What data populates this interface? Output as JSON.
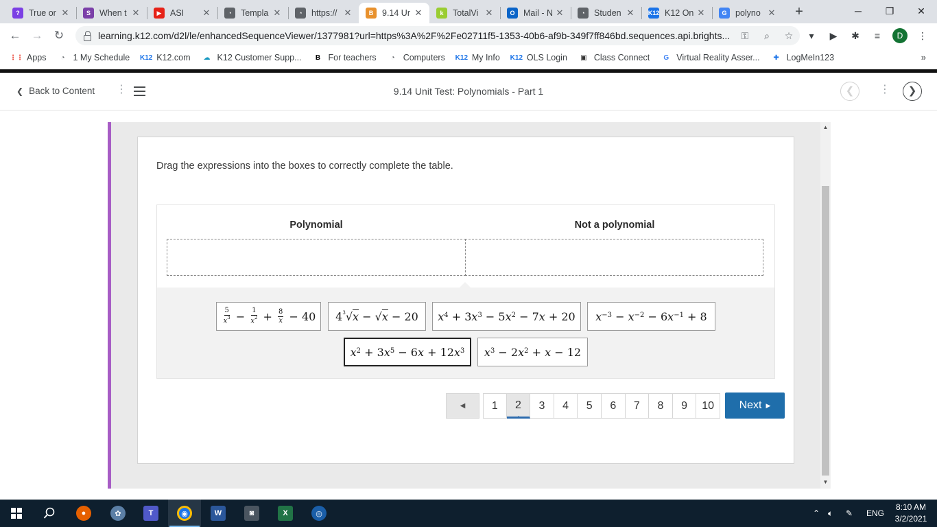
{
  "browser": {
    "tabs": [
      {
        "title": "True or",
        "fav": "?",
        "color": "#7b3fe4"
      },
      {
        "title": "When t",
        "fav": "S",
        "color": "#7b3fa8"
      },
      {
        "title": "ASI",
        "fav": "▶",
        "color": "#e62117"
      },
      {
        "title": "Templa",
        "fav": "◔",
        "color": "#5f6368"
      },
      {
        "title": "https://",
        "fav": "◔",
        "color": "#5f6368"
      },
      {
        "title": "9.14 Ur",
        "fav": "B",
        "color": "#e8912d"
      },
      {
        "title": "TotalVi",
        "fav": "k",
        "color": "#9acd32"
      },
      {
        "title": "Mail - N",
        "fav": "O",
        "color": "#0a64c8"
      },
      {
        "title": "Studen",
        "fav": "◔",
        "color": "#5f6368"
      },
      {
        "title": "K12 On",
        "fav": "K12",
        "color": "#1a73e8"
      },
      {
        "title": "polyno",
        "fav": "G",
        "color": "#4285f4"
      }
    ],
    "url": "learning.k12.com/d2l/le/enhancedSequenceViewer/1377981?url=https%3A%2F%2Fe02711f5-1353-40b6-af9b-349f7ff846bd.sequences.api.brights...",
    "avatar_letter": "D",
    "bookmarks": [
      {
        "label": "Apps",
        "icon": "apps-grid-icon"
      },
      {
        "label": "1 My Schedule",
        "icon": "globe-icon"
      },
      {
        "label": "K12.com",
        "icon": "k12-icon"
      },
      {
        "label": "K12 Customer Supp...",
        "icon": "cloud-icon"
      },
      {
        "label": "For teachers",
        "icon": "brainly-icon"
      },
      {
        "label": "Computers",
        "icon": "globe-icon"
      },
      {
        "label": "My Info",
        "icon": "k12-icon"
      },
      {
        "label": "OLS Login",
        "icon": "k12-icon"
      },
      {
        "label": "Class Connect",
        "icon": "video-icon"
      },
      {
        "label": "Virtual Reality Asser...",
        "icon": "google-icon"
      },
      {
        "label": "LogMeIn123",
        "icon": "logmein-icon"
      }
    ],
    "more_bookmarks": "»"
  },
  "nav": {
    "back_label": "Back to Content",
    "page_title": "9.14 Unit Test: Polynomials - Part 1"
  },
  "question": {
    "instructions": "Drag the expressions into the boxes to correctly complete the table.",
    "columns": [
      "Polynomial",
      "Not a polynomial"
    ]
  },
  "pagination": {
    "pages": [
      "1",
      "2",
      "3",
      "4",
      "5",
      "6",
      "7",
      "8",
      "9",
      "10"
    ],
    "current": "2",
    "next_label": "Next"
  },
  "taskbar": {
    "language": "ENG",
    "time": "8:10 AM",
    "date": "3/2/2021"
  },
  "colors": {
    "accent_purple": "#a75dc5",
    "next_blue": "#1f6eab"
  }
}
